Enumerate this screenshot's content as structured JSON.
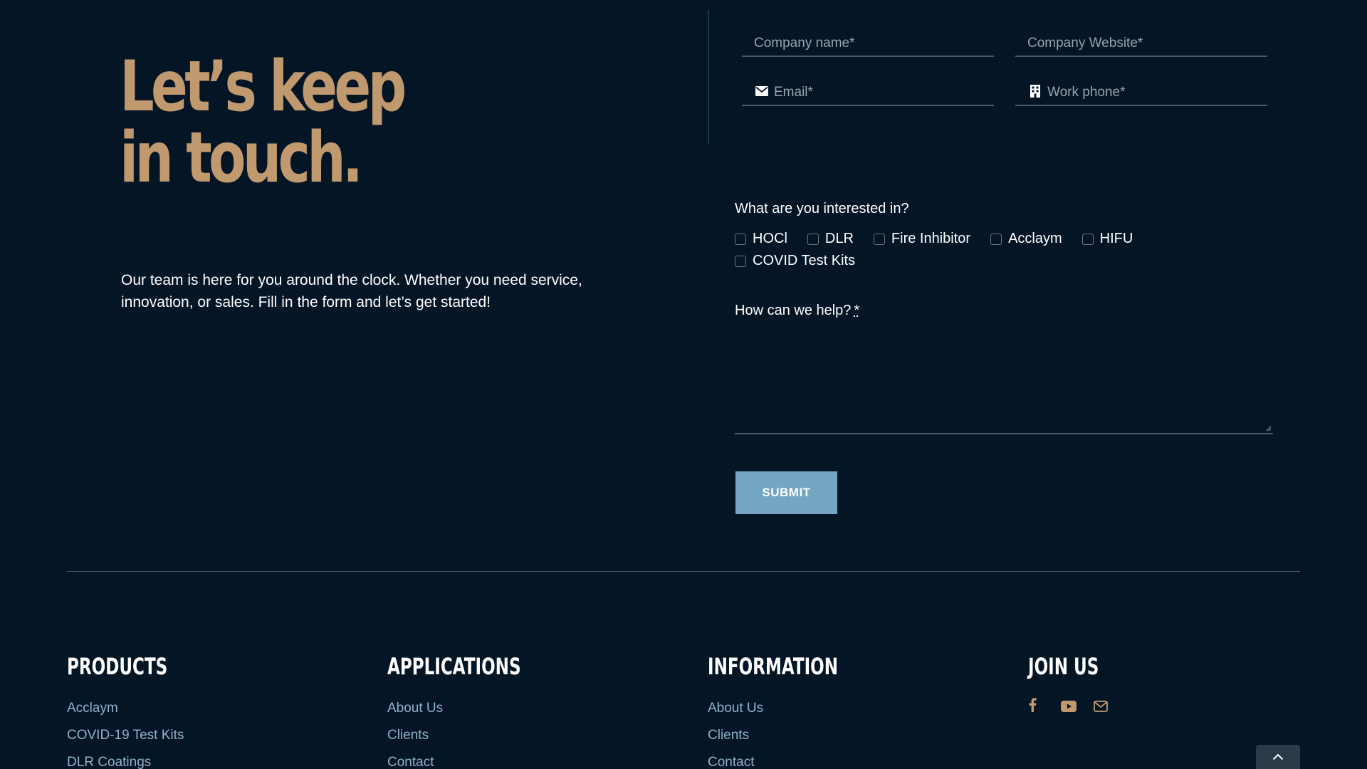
{
  "hero": {
    "title_line1": "Let’s keep",
    "title_line2": "in touch.",
    "intro": "Our team is here for you around the clock. Whether you need service, innovation, or sales. Fill in the form and let’s get started!"
  },
  "form": {
    "company_name_placeholder": "Company name*",
    "company_website_placeholder": "Company Website*",
    "email_placeholder": "Email*",
    "phone_placeholder": "Work phone*",
    "interest_label": "What are you interested in?",
    "interests": [
      "HOCl",
      "DLR",
      "Fire Inhibitor",
      "Acclaym",
      "HIFU",
      "COVID Test Kits"
    ],
    "help_label": "How can we help?",
    "help_required": "*",
    "submit_label": "SUBMIT"
  },
  "footer": {
    "products": {
      "heading": "PRODUCTS",
      "links": [
        "Acclaym",
        "COVID-19 Test Kits",
        "DLR Coatings"
      ]
    },
    "applications": {
      "heading": "APPLICATIONS",
      "links": [
        "About Us",
        "Clients",
        "Contact"
      ]
    },
    "information": {
      "heading": "INFORMATION",
      "links": [
        "About Us",
        "Clients",
        "Contact"
      ]
    },
    "join": {
      "heading": "JOIN US",
      "icons": [
        "facebook-icon",
        "youtube-icon",
        "envelope-icon"
      ]
    }
  },
  "colors": {
    "background": "#041526",
    "accent_gold": "#c09a6e",
    "button_blue": "#72a6c2",
    "link_blue": "#8fb3c9"
  }
}
